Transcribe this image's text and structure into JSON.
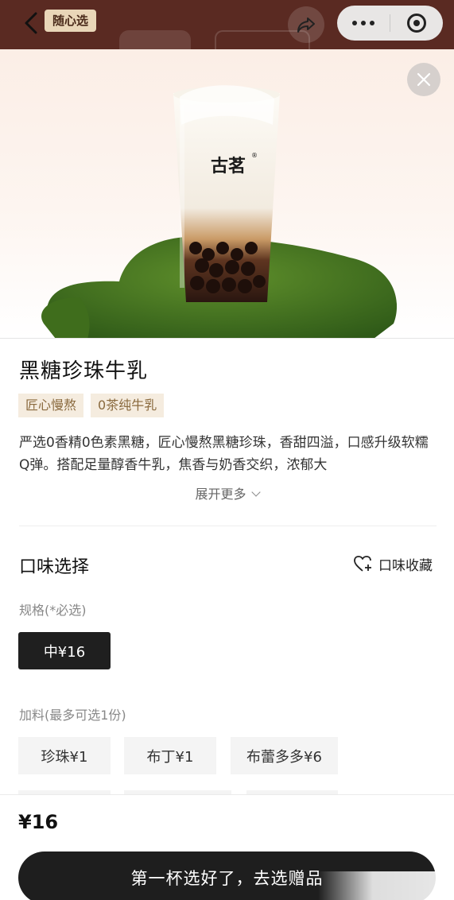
{
  "topbar": {
    "store_tag": "随心选"
  },
  "hero": {
    "cup_brand": "古茗",
    "cup_brand_mark": "®"
  },
  "product": {
    "name": "黑糖珍珠牛乳",
    "tags": [
      "匠心慢熬",
      "0茶纯牛乳"
    ],
    "description": "严选0香精0色素黑糖，匠心慢熬黑糖珍珠，香甜四溢，口感升级软糯Q弹。搭配足量醇香牛乳，焦香与奶香交织，浓郁大",
    "expand_label": "展开更多"
  },
  "options": {
    "section_title": "口味选择",
    "favorite_label": "口味收藏",
    "size_label": "规格(*必选)",
    "sizes": [
      {
        "label": "中¥16",
        "selected": true
      }
    ],
    "topping_label": "加料(最多可选1份)",
    "toppings": [
      {
        "label": "珍珠¥1"
      },
      {
        "label": "布丁¥1"
      },
      {
        "label": "布蕾多多¥6"
      }
    ]
  },
  "footer": {
    "price": "¥16",
    "cta_label": "第一杯选好了，去选赠品"
  },
  "colors": {
    "topbar_bg": "#5a2a22",
    "tag_bg": "#f5ecdf",
    "tag_text": "#8a6a3e",
    "selected_bg": "#1f1f1f",
    "cta_bg": "#1e1e1e"
  }
}
